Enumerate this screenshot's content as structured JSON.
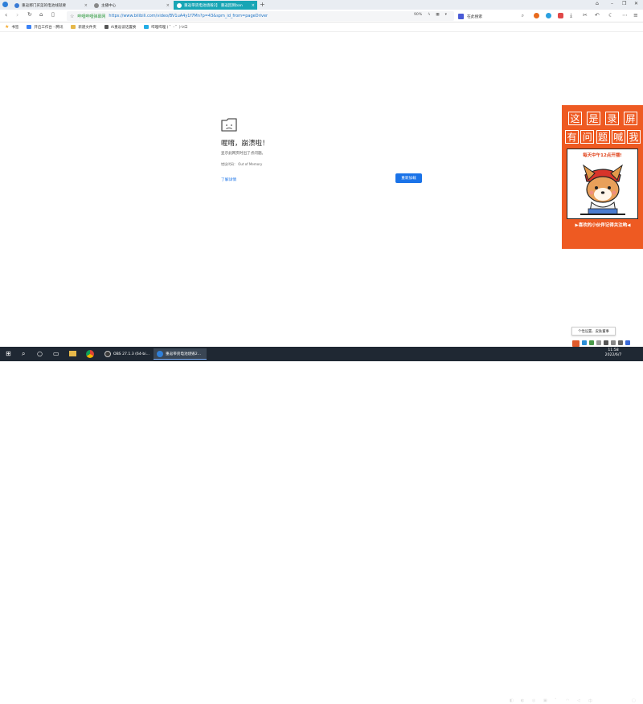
{
  "tabs": [
    {
      "label": "重返那门买菜的电池线就要",
      "fav_color": "#3a7bd5",
      "active": false
    },
    {
      "label": "主播中心",
      "fav_color": "#888888",
      "active": false
    },
    {
      "label": "重返带货电池烧毁2】 重返回到ban",
      "fav_color": "#ffffff",
      "active": true
    }
  ],
  "address_bar": {
    "site_name": "哔哩哔哩弹幕网",
    "url": "https://www.bilibili.com/video/BV1uA4y1f7Mn?p=43&spm_id_from=pageDriver",
    "zoom": "90%",
    "search_engine_label": "在此搜索"
  },
  "bookmarks": [
    {
      "label": "书签",
      "icon": "star-icon",
      "color": "#f5a623"
    },
    {
      "label": "开启工作台 - 腾讯",
      "icon": "shield-icon",
      "color": "#3b82f6"
    },
    {
      "label": "新建文件夹",
      "icon": "folder-icon",
      "color": "#e6b84a"
    },
    {
      "label": "Ai重返谈话置换",
      "icon": "ai-icon",
      "color": "#555555"
    },
    {
      "label": "哔哩哔哩 ( ゜- ゜)つロ",
      "icon": "bilibili-icon",
      "color": "#23ade5"
    }
  ],
  "crash": {
    "title": "喔唷，崩溃啦！",
    "description": "显示此网页时出了点问题。",
    "error_code": "错误代码： Out of Memory",
    "learn_more": "了解详情",
    "reload": "重新加载"
  },
  "promo": {
    "row1": [
      "这",
      "是",
      "录",
      "屏"
    ],
    "row2": [
      "有",
      "问",
      "题",
      "喊",
      "我"
    ],
    "caption": "每天中午12点开播!",
    "footer": "▶喜欢的小伙伴记得关注哟◀"
  },
  "toast": "个性设置、皮肤董事",
  "taskbar": {
    "apps": [
      {
        "label": "OBS 27.1.3 (64-bi...",
        "color": "#3b3b3b",
        "active": false
      },
      {
        "label": "重返带货电池烧毁2...",
        "color": "#2f7fd8",
        "active": true
      }
    ],
    "clock_time": "11:58",
    "clock_date": "2022/6/7"
  }
}
